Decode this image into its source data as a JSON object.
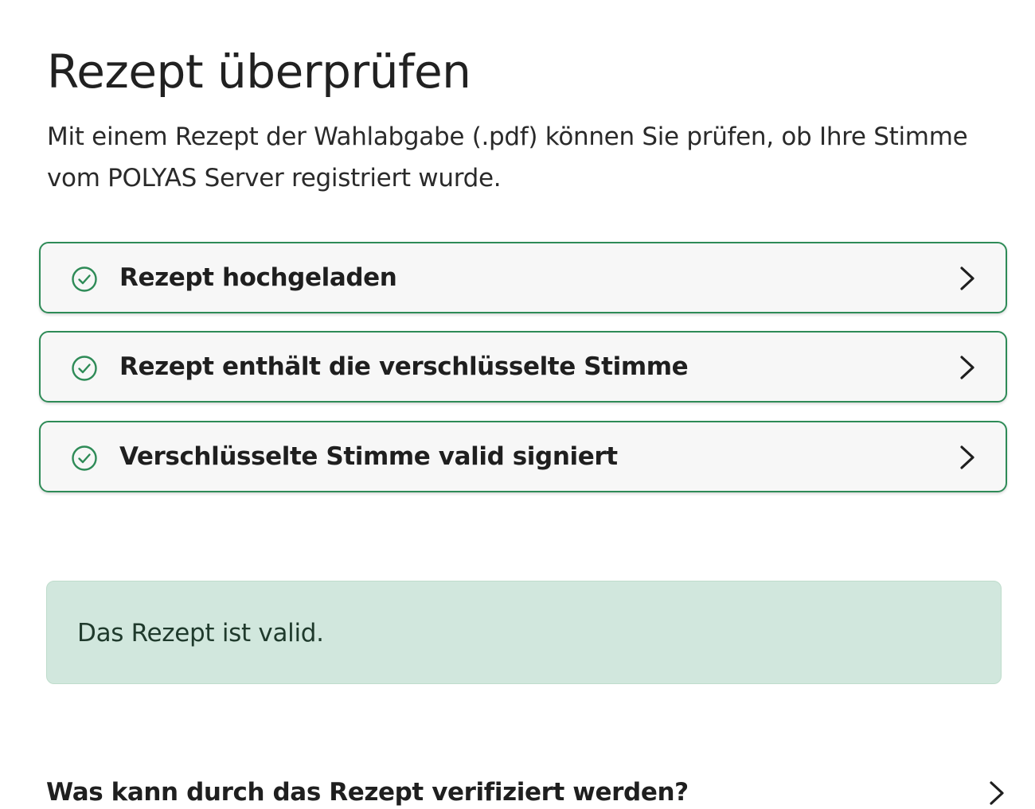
{
  "page": {
    "title": "Rezept überprüfen",
    "description": "Mit einem Rezept der Wahlabgabe (.pdf) können Sie prüfen, ob Ihre Stimme vom POLYAS Server registriert wurde."
  },
  "steps": [
    {
      "label": "Rezept hochgeladen",
      "status": "success",
      "icon": "check-circle-icon"
    },
    {
      "label": "Rezept enthält die verschlüsselte Stimme",
      "status": "success",
      "icon": "check-circle-icon"
    },
    {
      "label": "Verschlüsselte Stimme valid signiert",
      "status": "success",
      "icon": "check-circle-icon"
    }
  ],
  "result": {
    "message": "Das Rezept ist valid.",
    "status": "success"
  },
  "faq": {
    "question": "Was kann durch das Rezept verifiziert werden?"
  },
  "colors": {
    "success_border": "#2e8b57",
    "success_bg": "#d1e7dd",
    "step_bg": "#f7f7f7"
  }
}
